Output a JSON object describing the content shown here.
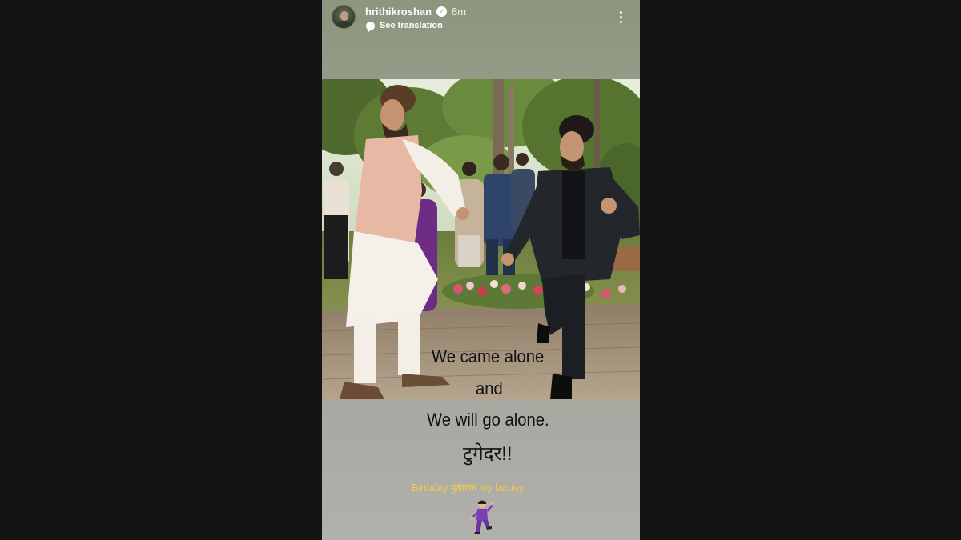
{
  "story": {
    "username": "hrithikroshan",
    "verified_icon": "verified-badge-icon",
    "time": "8m",
    "see_translation": "See translation",
    "more_icon": "more-vertical-icon"
  },
  "caption": {
    "line1": "We came alone",
    "line2": "and",
    "line3": "We will go alone.",
    "line4": "टुगेदर!!"
  },
  "birthday_text": "Birthday मुबारक my bwuoy!",
  "emoji": "man-dancing-emoji",
  "colors": {
    "background": "#141414",
    "story_bg": "#9aa08d",
    "birthday_text": "#f2c94c"
  }
}
